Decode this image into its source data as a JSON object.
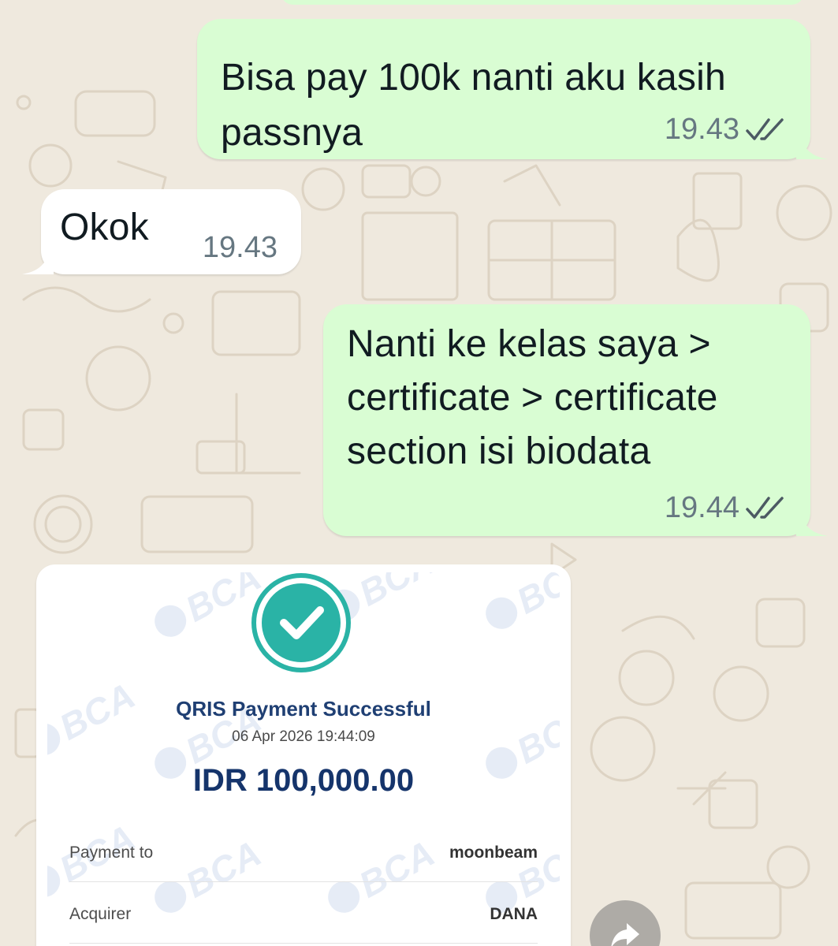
{
  "colors": {
    "outgoing_bubble": "#d9fdd3",
    "incoming_bubble": "#ffffff",
    "wallpaper": "#efe9de",
    "read_ticks": "#667781",
    "success_teal": "#2ab3a6",
    "bca_navy": "#15346b"
  },
  "messages": [
    {
      "direction": "outgoing",
      "lines": [
        "Bisa pay 100k nanti aku kasih",
        "passnya"
      ],
      "time": "19.43",
      "status_icon": "double-check-icon"
    },
    {
      "direction": "incoming",
      "lines": [
        "Okok"
      ],
      "time": "19.43"
    },
    {
      "direction": "outgoing",
      "lines": [
        "Nanti ke kelas saya >",
        "certificate > certificate",
        "section isi biodata"
      ],
      "time": "19.44",
      "status_icon": "double-check-icon"
    }
  ],
  "receipt": {
    "watermark": "BCA",
    "status_icon": "check-circle-icon",
    "title": "QRIS Payment Successful",
    "datetime": "06 Apr 2026 19:44:09",
    "amount": "IDR 100,000.00",
    "rows": [
      {
        "label": "Payment to",
        "value": "moonbeam"
      },
      {
        "label": "Acquirer",
        "value": "DANA"
      }
    ]
  },
  "share_button": {
    "icon": "forward-arrow-icon"
  }
}
